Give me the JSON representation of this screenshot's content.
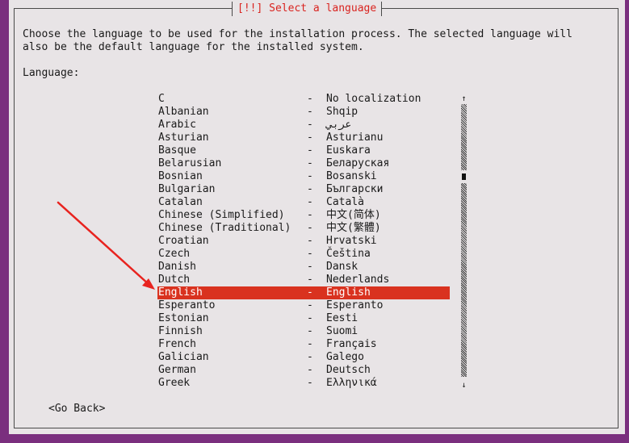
{
  "dialog": {
    "title": "[!!] Select a language",
    "intro_line1": "Choose the language to be used for the installation process. The selected language will",
    "intro_line2": "also be the default language for the installed system.",
    "language_label": "Language:",
    "go_back_label": "<Go Back>",
    "separator": "-"
  },
  "languages": [
    {
      "name": "C",
      "native": "No localization"
    },
    {
      "name": "Albanian",
      "native": "Shqip"
    },
    {
      "name": "Arabic",
      "native": "عربي"
    },
    {
      "name": "Asturian",
      "native": "Asturianu"
    },
    {
      "name": "Basque",
      "native": "Euskara"
    },
    {
      "name": "Belarusian",
      "native": "Беларуская"
    },
    {
      "name": "Bosnian",
      "native": "Bosanski"
    },
    {
      "name": "Bulgarian",
      "native": "Български"
    },
    {
      "name": "Catalan",
      "native": "Català"
    },
    {
      "name": "Chinese (Simplified)",
      "native": "中文(简体)"
    },
    {
      "name": "Chinese (Traditional)",
      "native": "中文(繁體)"
    },
    {
      "name": "Croatian",
      "native": "Hrvatski"
    },
    {
      "name": "Czech",
      "native": "Čeština"
    },
    {
      "name": "Danish",
      "native": "Dansk"
    },
    {
      "name": "Dutch",
      "native": "Nederlands"
    },
    {
      "name": "English",
      "native": "English",
      "selected": true
    },
    {
      "name": "Esperanto",
      "native": "Esperanto"
    },
    {
      "name": "Estonian",
      "native": "Eesti"
    },
    {
      "name": "Finnish",
      "native": "Suomi"
    },
    {
      "name": "French",
      "native": "Français"
    },
    {
      "name": "Galician",
      "native": "Galego"
    },
    {
      "name": "German",
      "native": "Deutsch"
    },
    {
      "name": "Greek",
      "native": "Ελληνικά"
    }
  ],
  "icons": {
    "scroll_up": "↑",
    "scroll_down": "↓"
  },
  "colors": {
    "background": "#7a2f7e",
    "dialog": "#e8e4e6",
    "title": "#d9231f",
    "selection": "#d9321f",
    "annotation_arrow": "#e8231f"
  }
}
